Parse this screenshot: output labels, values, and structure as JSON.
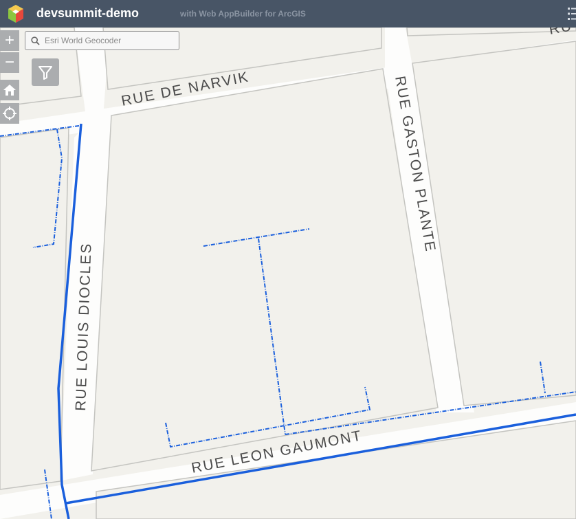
{
  "app": {
    "title": "devsummit-demo",
    "subtitle": "with Web AppBuilder for ArcGIS"
  },
  "controls": {
    "zoom_in": "+",
    "zoom_out": "−"
  },
  "search": {
    "placeholder": "Esri World Geocoder"
  },
  "map": {
    "streets": {
      "narvik": "RUE DE NARVIK",
      "gaston": "RUE GASTON PLANTE",
      "diocles": "RUE LOUIS DIOCLES",
      "gaumont": "RUE LEON GAUMONT",
      "corner": "RU"
    }
  }
}
